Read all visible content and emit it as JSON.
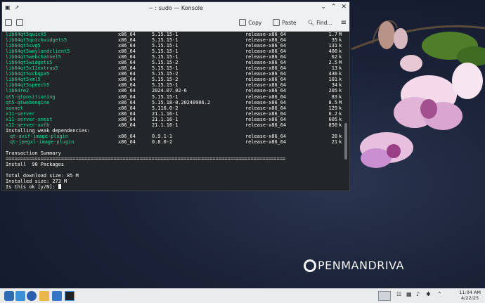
{
  "window": {
    "title": "~ : sudo — Konsole",
    "toolbar": {
      "copy_label": "Copy",
      "paste_label": "Paste",
      "find_label": "Find..."
    }
  },
  "terminal": {
    "rows": [
      [
        "lib64qt5quick5",
        "x86_64",
        "5.15.15-1",
        "release-x86_64",
        "1.7",
        "M"
      ],
      [
        "lib64qt5quickwidgets5",
        "x86_64",
        "5.15.15-1",
        "release-x86_64",
        "35",
        "k"
      ],
      [
        "lib64qt5svg5",
        "x86_64",
        "5.15.15-1",
        "release-x86_64",
        "131",
        "k"
      ],
      [
        "lib64qt5waylandclient5",
        "x86_64",
        "5.15.15-1",
        "release-x86_64",
        "400",
        "k"
      ],
      [
        "lib64qt5webchannel5",
        "x86_64",
        "5.15.15-1",
        "release-x86_64",
        "62",
        "k"
      ],
      [
        "lib64qt5widgets5",
        "x86_64",
        "5.15.15-2",
        "release-x86_64",
        "2.5",
        "M"
      ],
      [
        "lib64qt5x11extras5",
        "x86_64",
        "5.15.15-1",
        "release-x86_64",
        "13",
        "k"
      ],
      [
        "lib64qt5xcbqpa5",
        "x86_64",
        "5.15.15-2",
        "release-x86_64",
        "436",
        "k"
      ],
      [
        "lib64qt5xml5",
        "x86_64",
        "5.15.15-2",
        "release-x86_64",
        "101",
        "k"
      ],
      [
        "lib64qt5speech5",
        "x86_64",
        "5.15.15-1",
        "release-x86_64",
        "34",
        "k"
      ],
      [
        "lib64re2",
        "x86_64",
        "2024.07.02-6",
        "release-x86_64",
        "205",
        "k"
      ],
      [
        "qt5-qtpositioning",
        "x86_64",
        "5.15.15-1",
        "release-x86_64",
        "83",
        "k"
      ],
      [
        "qt5-qtwebengine",
        "x86_64",
        "5.15.18-0.20240906.2",
        "release-x86_64",
        "8.5",
        "M"
      ],
      [
        "sonnet",
        "x86_64",
        "5.116.0-2",
        "release-x86_64",
        "129",
        "k"
      ],
      [
        "x11-server",
        "x86_64",
        "21.1.16-1",
        "release-x86_64",
        "6.2",
        "k"
      ],
      [
        "x11-server-xnest",
        "x86_64",
        "21.1.16-1",
        "release-x86_64",
        "605",
        "k"
      ],
      [
        "x11-server-xvfb",
        "x86_64",
        "21.1.16-1",
        "release-x86_64",
        "850",
        "k"
      ]
    ],
    "weak_heading": "Installing weak dependencies:",
    "weak_rows": [
      [
        "qt-avif-image-plugin",
        "x86_64",
        "0.9.1-1",
        "release-x86_64",
        "20",
        "k"
      ],
      [
        "qt-jpegxl-image-plugin",
        "x86_64",
        "0.8.0-2",
        "release-x86_64",
        "21",
        "k"
      ]
    ],
    "summary_heading": "Transaction Summary",
    "separator": "================================================================================================",
    "install_line": "Install  90 Packages",
    "download_size": "Total download size: 85 M",
    "installed_size": "Installed size: 273 M",
    "prompt": "Is this ok [y/N]: "
  },
  "desktop": {
    "logo_text": "PENMANDRIVA"
  },
  "taskbar": {
    "time": "11:04 AM",
    "date": "4/22/25"
  },
  "colors": {
    "package_green": "#1cdc9a",
    "terminal_bg": "#232629",
    "orchid": "#c98fd0"
  }
}
